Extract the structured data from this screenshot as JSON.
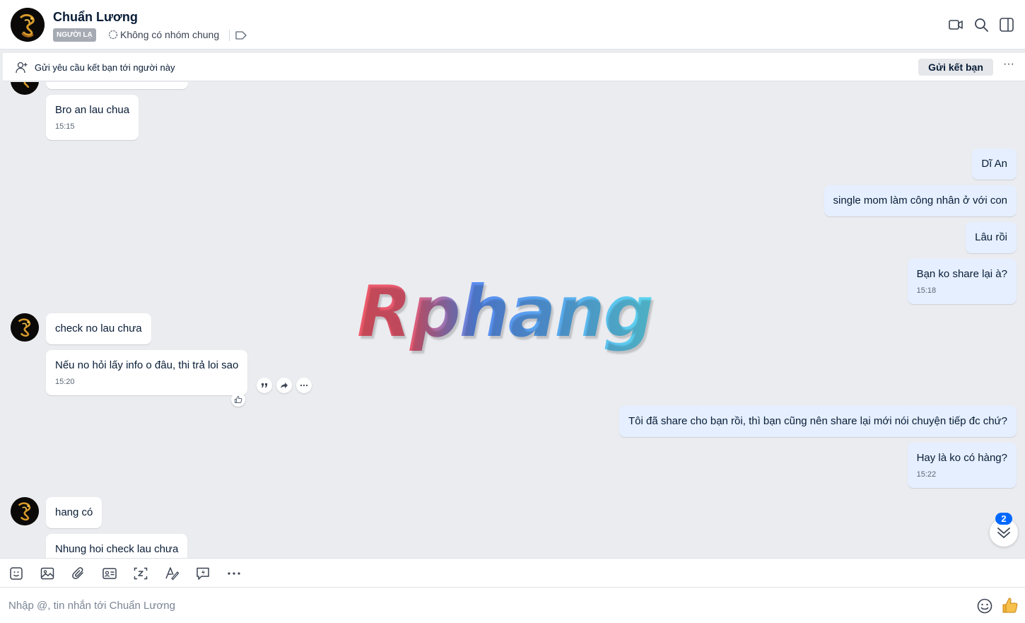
{
  "header": {
    "name": "Chuẩn Lương",
    "badge": "NGƯỜI LẠ",
    "no_group": "Không có nhóm chung",
    "icons": [
      "video-call-icon",
      "search-icon",
      "toggle-sidebar-icon"
    ]
  },
  "friend_request": {
    "text": "Gửi yêu cầu kết bạn tới người này",
    "button": "Gửi kết bạn",
    "more": "···"
  },
  "messages": {
    "m1": {
      "text": "Bro an lau chua",
      "time": "15:15"
    },
    "m2": {
      "text": "Dĩ An"
    },
    "m3": {
      "text": "single mom làm công nhân ở với con"
    },
    "m4": {
      "text": "Lâu rồi"
    },
    "m5": {
      "text": "Bạn ko share lại à?",
      "time": "15:18"
    },
    "m6": {
      "text": "check no lau chưa"
    },
    "m7": {
      "text": "Nếu no hỏi lấy info o đâu, thi trả loi sao",
      "time": "15:20"
    },
    "m8": {
      "text": "Tôi đã share cho bạn rồi, thì bạn cũng nên share lại mới nói chuyện tiếp đc chứ?"
    },
    "m9": {
      "text": "Hay là ko có hàng?",
      "time": "15:22"
    },
    "m10": {
      "text": "hang có"
    },
    "m11": {
      "text": "Nhung hoi check lau chưa"
    }
  },
  "watermark": "Rphang",
  "unread_count": "2",
  "composer": {
    "placeholder": "Nhập @, tin nhắn tới Chuẩn Lương"
  },
  "toolbar_icons": [
    "sticker-icon",
    "image-icon",
    "attach-icon",
    "contact-card-icon",
    "screenshot-icon",
    "text-format-icon",
    "quick-message-icon",
    "more-icon"
  ],
  "colors": {
    "accent": "#0068ff",
    "incoming_bubble": "#ffffff",
    "outgoing_bubble": "#e5efff",
    "background": "#ebecf0"
  }
}
